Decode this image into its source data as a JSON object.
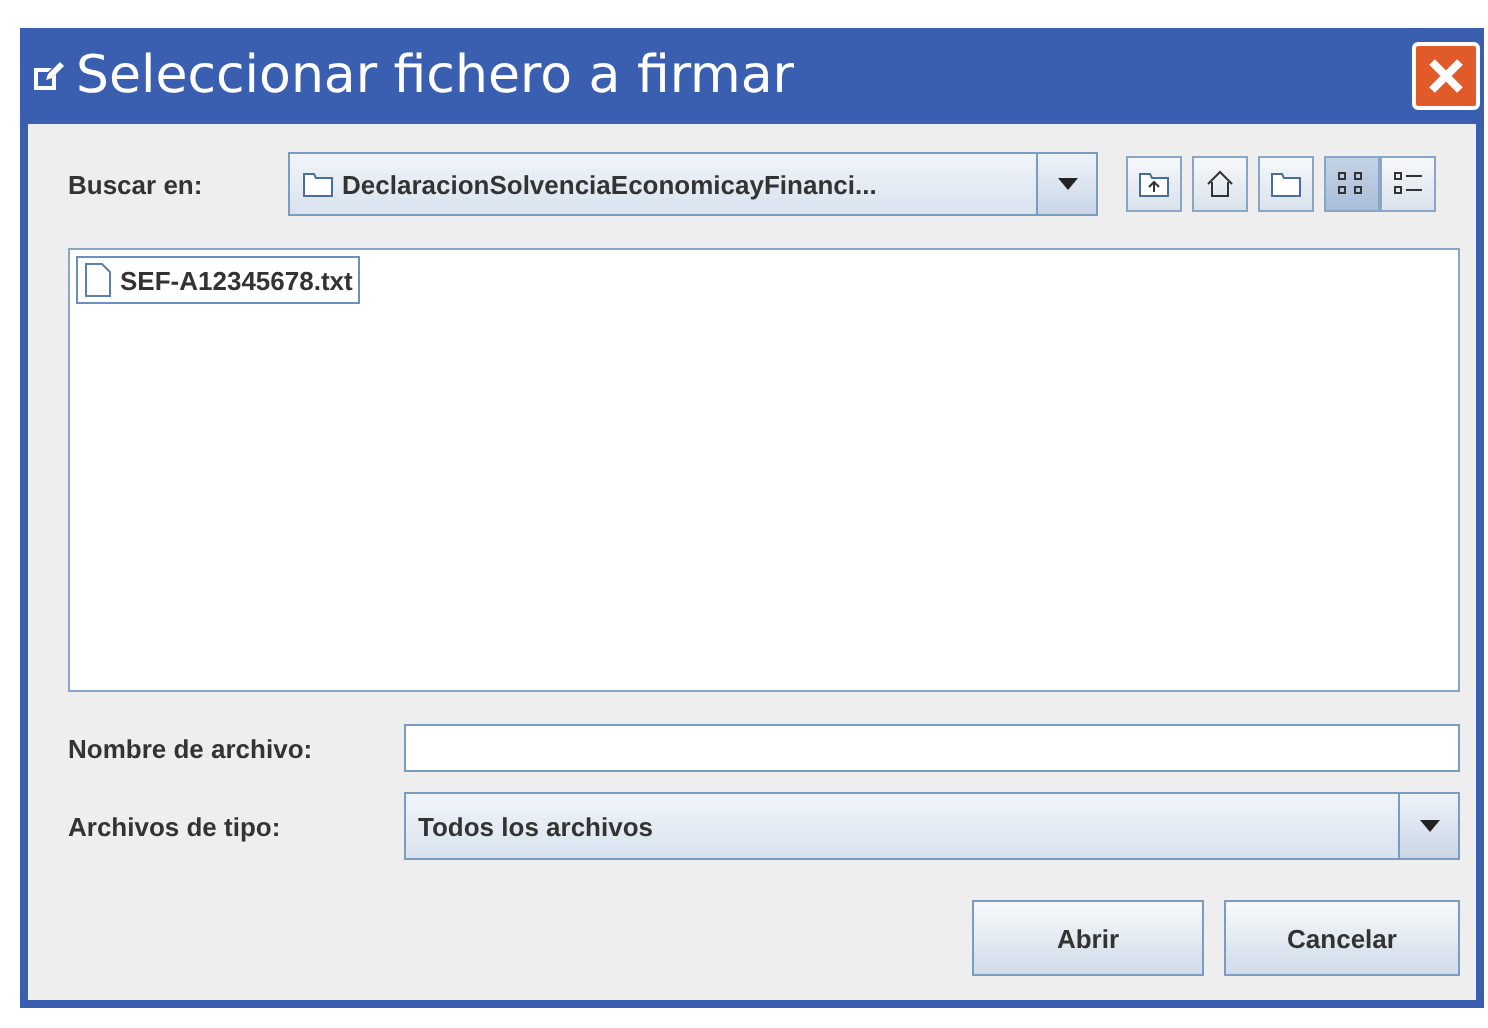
{
  "window": {
    "title": "Seleccionar fichero a firmar"
  },
  "look_in": {
    "label": "Buscar en:",
    "value": "DeclaracionSolvenciaEconomicayFinanci..."
  },
  "toolbar": [
    {
      "kind": "up",
      "selected": false
    },
    {
      "kind": "home",
      "selected": false
    },
    {
      "kind": "newfolder",
      "selected": false
    },
    {
      "kind": "list",
      "selected": true
    },
    {
      "kind": "details",
      "selected": false
    }
  ],
  "files": [
    {
      "name": "SEF-A12345678.txt",
      "selected": true
    }
  ],
  "file_name": {
    "label": "Nombre de archivo:"
  },
  "file_type": {
    "label": "Archivos de tipo:",
    "value": "Todos los archivos"
  },
  "buttons": [
    "Abrir",
    "Cancelar"
  ]
}
